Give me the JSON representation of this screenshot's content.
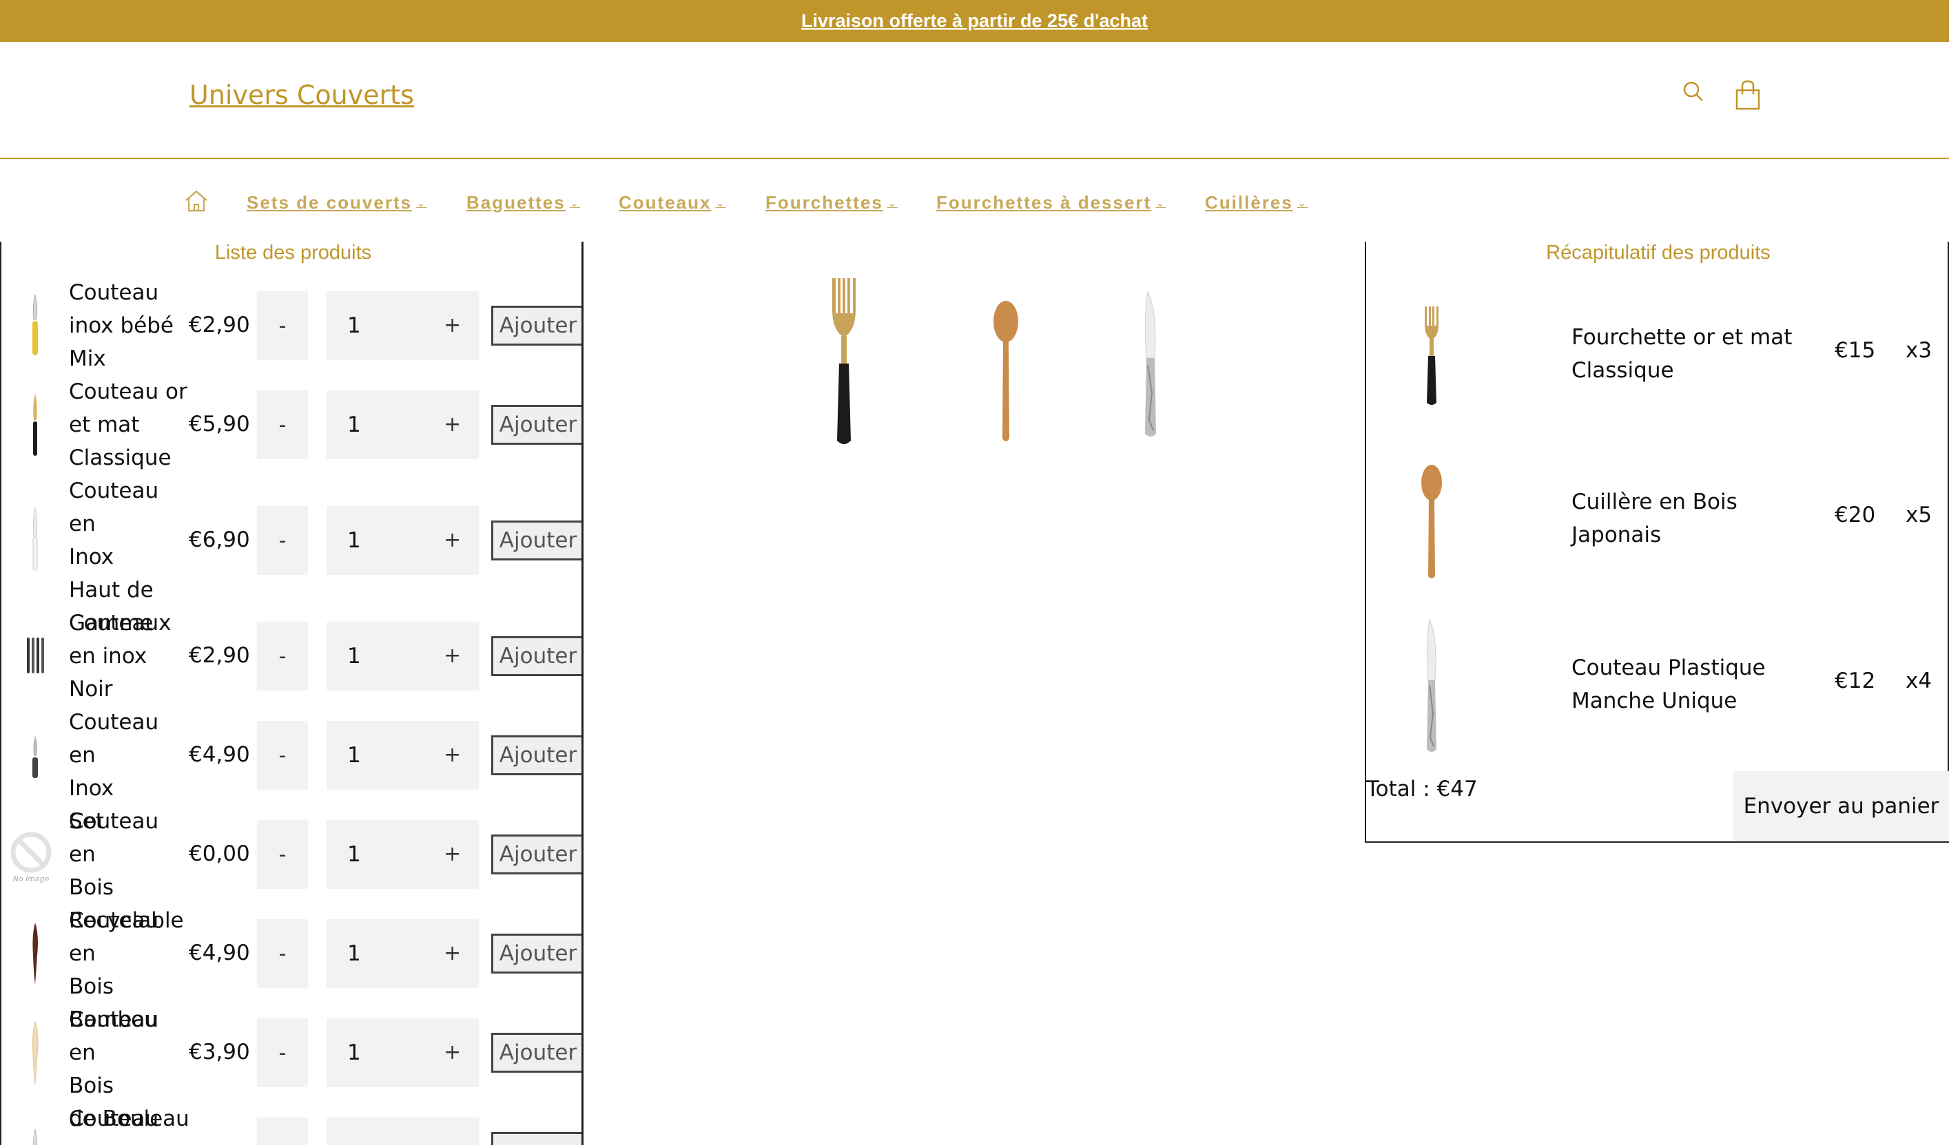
{
  "announcement": {
    "text": "Livraison offerte à partir de 25€ d'achat"
  },
  "header": {
    "logo": "Univers Couverts",
    "icons": [
      "search-icon",
      "cart-icon"
    ]
  },
  "nav": {
    "home_icon": "home-icon",
    "items": [
      {
        "label": "Sets de couverts"
      },
      {
        "label": "Baguettes"
      },
      {
        "label": "Couteaux"
      },
      {
        "label": "Fourchettes"
      },
      {
        "label": "Fourchettes à dessert"
      },
      {
        "label": "Cuillères"
      }
    ]
  },
  "product_list": {
    "title": "Liste des produits",
    "minus_label": "-",
    "plus_label": "+",
    "add_label": "Ajouter",
    "items": [
      {
        "name_lines": [
          "Couteau",
          "inox bébé",
          "Mix"
        ],
        "price": "€2,90",
        "qty": "1"
      },
      {
        "name_lines": [
          "Couteau or",
          "et mat",
          "Classique"
        ],
        "price": "€5,90",
        "qty": "1"
      },
      {
        "name_lines": [
          "Couteau en",
          "Inox",
          "Haut de",
          "Gamme"
        ],
        "price": "€6,90",
        "qty": "1"
      },
      {
        "name_lines": [
          "Couteaux",
          "en inox",
          "Noir"
        ],
        "price": "€2,90",
        "qty": "1"
      },
      {
        "name_lines": [
          "Couteau en",
          "Inox",
          "Set"
        ],
        "price": "€4,90",
        "qty": "1"
      },
      {
        "name_lines": [
          "Couteau en",
          "Bois",
          "Recyclable"
        ],
        "price": "€0,00",
        "qty": "1",
        "no_image_label": "No image"
      },
      {
        "name_lines": [
          "Couteau en",
          "Bois",
          "Bambou"
        ],
        "price": "€4,90",
        "qty": "1"
      },
      {
        "name_lines": [
          "Couteau en",
          "Bois",
          "de Bouleau"
        ],
        "price": "€3,90",
        "qty": "1"
      },
      {
        "name_lines": [
          "Couteau en"
        ],
        "price": "",
        "qty": ""
      }
    ]
  },
  "summary": {
    "title": "Récapitulatif des produits",
    "items": [
      {
        "name": "Fourchette or et mat Classique",
        "price": "€15",
        "qty": "x3"
      },
      {
        "name": "Cuillère en Bois Japonais",
        "price": "€20",
        "qty": "x5"
      },
      {
        "name": "Couteau Plastique Manche Unique",
        "price": "€12",
        "qty": "x4"
      }
    ],
    "total": "Total : €47",
    "send_label": "Envoyer au panier"
  },
  "colors": {
    "accent": "#c0962a",
    "nav_text": "#c8a95a"
  }
}
